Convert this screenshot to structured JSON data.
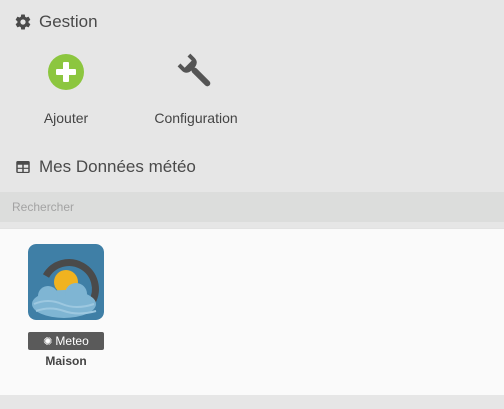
{
  "gestion": {
    "title": "Gestion",
    "actions": [
      {
        "label": "Ajouter",
        "icon": "plus-circle-icon",
        "color": "#8cc63f"
      },
      {
        "label": "Configuration",
        "icon": "wrench-icon",
        "color": "#555555"
      }
    ]
  },
  "donnees": {
    "title": "Mes Données météo",
    "search": {
      "placeholder": "Rechercher",
      "value": ""
    },
    "items": [
      {
        "badge": "Meteo",
        "badge_icon": "sun-icon",
        "name": "Maison",
        "icon": "weather-app-icon"
      }
    ]
  }
}
